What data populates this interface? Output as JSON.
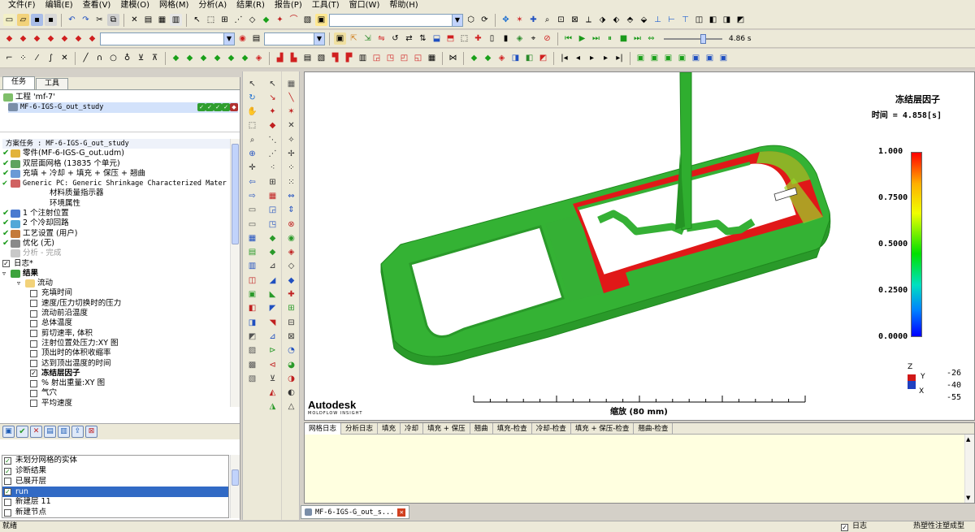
{
  "menu": [
    "文件(F)",
    "编辑(E)",
    "查看(V)",
    "建模(O)",
    "网格(M)",
    "分析(A)",
    "结果(R)",
    "报告(P)",
    "工具(T)",
    "窗口(W)",
    "帮助(H)"
  ],
  "toolbar": {
    "animation_time": "4.86 s"
  },
  "left_tabs": [
    "任务",
    "工具"
  ],
  "project": {
    "label": "工程 'mf-7'",
    "study": "MF-6-IGS-G_out_study"
  },
  "study_tasks": {
    "header": "方案任务 : MF-6-IGS-G_out_study",
    "items": [
      {
        "text": "零件(MF-6-IGS-G_out.udm)",
        "icon": "part-icon"
      },
      {
        "text": "双层面网格 (13835 个单元)",
        "icon": "mesh-icon"
      },
      {
        "text": "充填 + 冷却 + 填充 + 保压 + 翘曲",
        "icon": "analysis-sequence-icon"
      },
      {
        "text": "Generic PC: Generic Shrinkage Characterized Mater",
        "icon": "material-icon"
      },
      {
        "text": "材料质量指示器",
        "indent": true
      },
      {
        "text": "环境属性",
        "indent": true
      },
      {
        "text": "1 个注射位置",
        "icon": "injection-icon"
      },
      {
        "text": "2 个冷却回路",
        "icon": "cooling-icon"
      },
      {
        "text": "工艺设置 (用户)",
        "icon": "process-icon"
      },
      {
        "text": "优化 (无)",
        "icon": "optimize-icon"
      },
      {
        "text": "分析 - 完成",
        "icon": "analysis-icon",
        "disabled": true
      }
    ],
    "log": "日志*",
    "results": "结果",
    "flow": "流动",
    "result_items": [
      {
        "text": "充填时间",
        "checked": false
      },
      {
        "text": "速度/压力切换时的压力",
        "checked": false
      },
      {
        "text": "流动前沿温度",
        "checked": false
      },
      {
        "text": "总体温度",
        "checked": false
      },
      {
        "text": "剪切速率, 体积",
        "checked": false
      },
      {
        "text": "注射位置处压力:XY 图",
        "checked": false
      },
      {
        "text": "顶出时的体积收缩率",
        "checked": false
      },
      {
        "text": "达到顶出温度的时间",
        "checked": false
      },
      {
        "text": "冻结层因子",
        "checked": true
      },
      {
        "text": "% 射出重量:XY 图",
        "checked": false
      },
      {
        "text": "气穴",
        "checked": false
      },
      {
        "text": "平均速度",
        "checked": false
      }
    ]
  },
  "layers": [
    {
      "text": "未划分网格的实体",
      "checked": true
    },
    {
      "text": "诊断结果",
      "checked": true
    },
    {
      "text": "已展开层",
      "checked": false
    },
    {
      "text": "run",
      "checked": true,
      "selected": true
    },
    {
      "text": "新建层 11",
      "checked": false
    },
    {
      "text": "新建节点",
      "checked": false
    }
  ],
  "viewport": {
    "result_title": "冻结层因子",
    "time_label": "时间 = 4.858[s]",
    "scale_label": "缩放 (80 mm)",
    "logo_main": "Autodesk",
    "logo_sub": "MOLDFLOW INSIGHT",
    "triad_z": "Z",
    "triad_y": "Y",
    "triad_x": "X",
    "triad_angles": [
      "-26",
      "-40",
      "-55"
    ]
  },
  "chart_data": {
    "type": "heatmap",
    "title": "冻结层因子",
    "legend_values": [
      "1.000",
      "0.7500",
      "0.5000",
      "0.2500",
      "0.0000"
    ],
    "range": [
      0,
      1
    ],
    "colors": {
      "max": "#ff0000",
      "mid": "#00e000",
      "min": "#0000ff"
    }
  },
  "log_tabs": [
    "网格日志",
    "分析日志",
    "填充",
    "冷却",
    "填充 + 保压",
    "翘曲",
    "填充-检查",
    "冷却-检查",
    "填充 + 保压-检查",
    "翘曲-检查"
  ],
  "doc_tab": "MF-6-IGS-G_out_s...",
  "status": {
    "left": "就绪",
    "log_check": "日志",
    "right": "热塑性注塑成型"
  },
  "colors": {
    "accent_green": "#2f9e2f",
    "selection": "#316ac5",
    "model_green": "#35b035",
    "model_red": "#e01818"
  }
}
